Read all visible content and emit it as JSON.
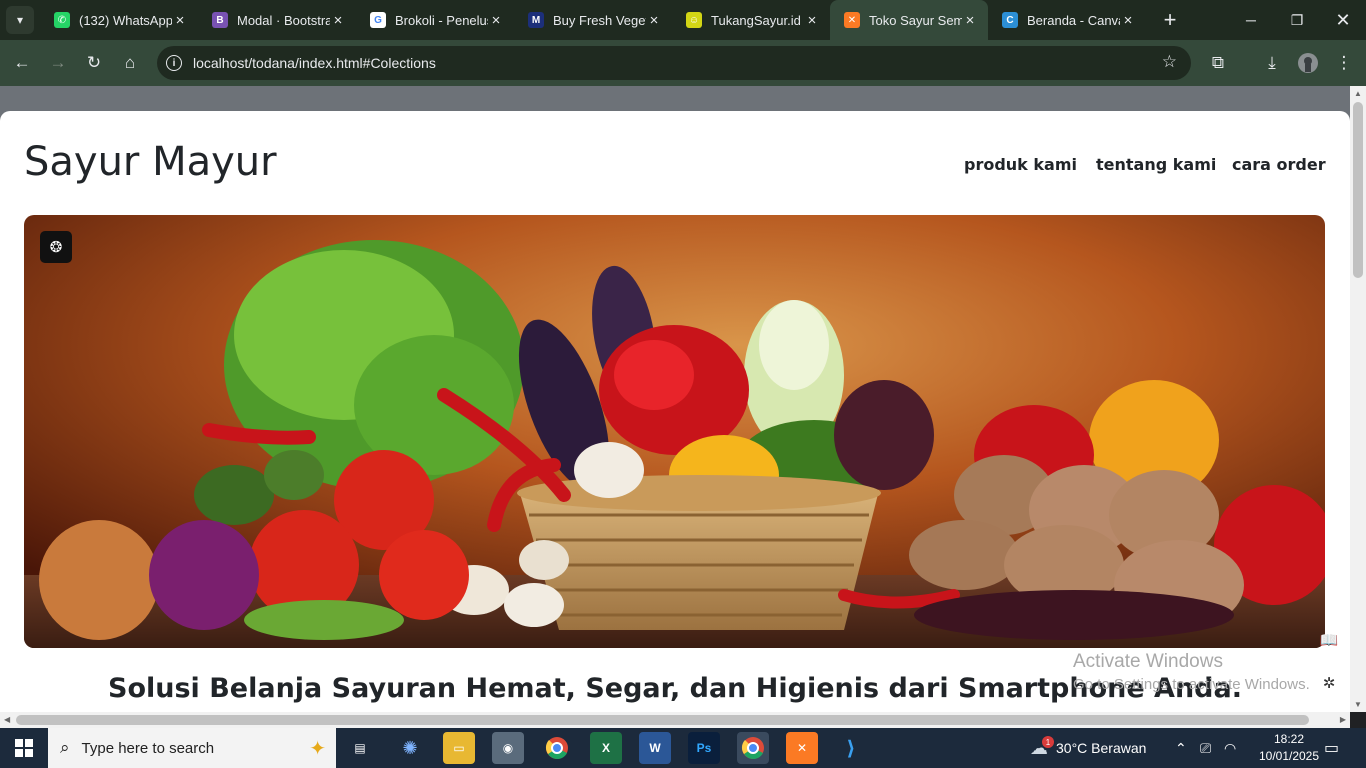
{
  "browser": {
    "tabs": [
      {
        "title": "(132) WhatsApp",
        "icon": "whatsapp-icon",
        "color": "#25d366",
        "glyph": "✆"
      },
      {
        "title": "Modal · Bootstrap",
        "icon": "bootstrap-icon",
        "color": "#7952b3",
        "glyph": "B"
      },
      {
        "title": "Brokoli - Penelusuran",
        "icon": "google-icon",
        "color": "#ffffff",
        "glyph": "G"
      },
      {
        "title": "Buy Fresh Vegetables",
        "icon": "m-logo-icon",
        "color": "#1c2f7a",
        "glyph": "M"
      },
      {
        "title": "TukangSayur.id",
        "icon": "tukangsayur-icon",
        "color": "#d3d615",
        "glyph": "☺"
      },
      {
        "title": "Toko Sayur Semarang",
        "icon": "xampp-icon",
        "color": "#fb7a24",
        "glyph": "✕",
        "active": true
      },
      {
        "title": "Beranda - Canva",
        "icon": "canva-icon",
        "color": "#2c8fd6",
        "glyph": "C"
      }
    ],
    "url": "localhost/todana/index.html#Colections"
  },
  "page": {
    "brand": "Sayur Mayur",
    "nav": [
      "produk kami",
      "tentang kami",
      "cara order"
    ],
    "headline": "Solusi Belanja Sayuran Hemat, Segar, dan Higienis dari Smartphone Anda."
  },
  "watermark": {
    "title": "Activate Windows",
    "subtitle": "Go to Settings to activate Windows."
  },
  "taskbar": {
    "search_placeholder": "Type here to search",
    "weather": "30°C  Berawan",
    "time": "18:22",
    "date": "10/01/2025",
    "weather_badge": "1"
  },
  "colors": {
    "tab_strip": "#1f2a20",
    "toolbar": "#34493a",
    "taskbar": "#1c2a3c"
  }
}
